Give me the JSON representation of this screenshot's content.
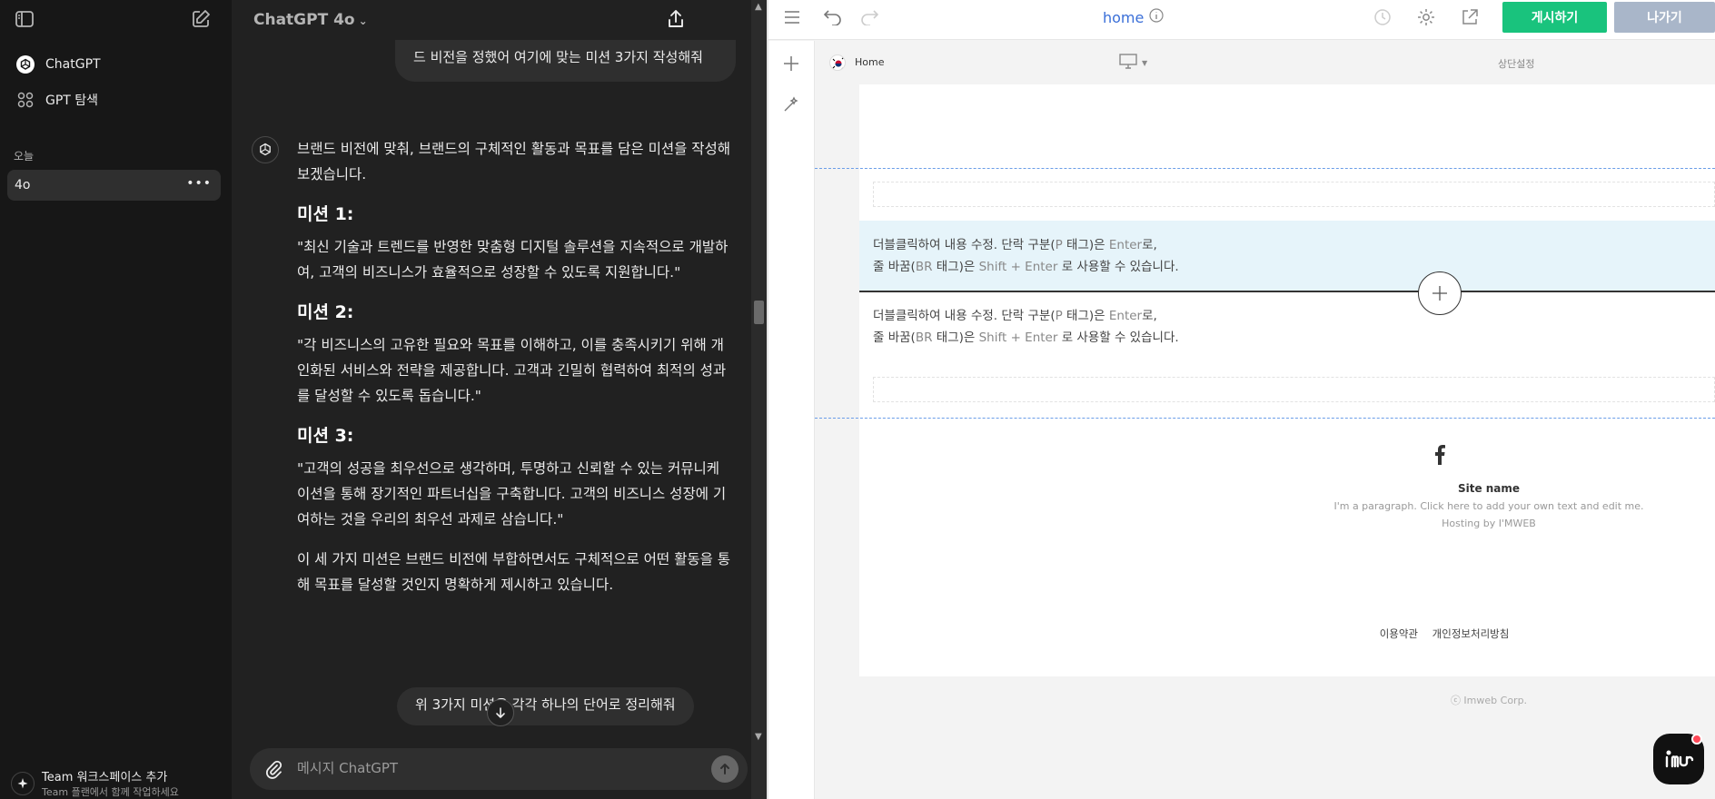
{
  "sidebar": {
    "items": [
      {
        "label": "ChatGPT",
        "icon": "chatgpt-logo-icon"
      },
      {
        "label": "GPT 탐색",
        "icon": "grid-icon"
      }
    ],
    "section_today": "오늘",
    "chat_title": "4o",
    "bottom_title": "Team 워크스페이스 추가",
    "bottom_subtitle": "Team 플랜에서 함께 작업하세요"
  },
  "chat": {
    "model": "ChatGPT 4o",
    "user_message_1": "드 비전을 정했어 여기에 맞는 미션 3가지 작성해줘",
    "ai_intro": "브랜드 비전에 맞춰, 브랜드의 구체적인 활동과 목표를 담은 미션을 작성해 보겠습니다.",
    "missions": [
      {
        "title": "미션 1:",
        "text": "\"최신 기술과 트렌드를 반영한 맞춤형 디지털 솔루션을 지속적으로 개발하여, 고객의 비즈니스가 효율적으로 성장할 수 있도록 지원합니다.\""
      },
      {
        "title": "미션 2:",
        "text": "\"각 비즈니스의 고유한 필요와 목표를 이해하고, 이를 충족시키기 위해 개인화된 서비스와 전략을 제공합니다. 고객과 긴밀히 협력하여 최적의 성과를 달성할 수 있도록 돕습니다.\""
      },
      {
        "title": "미션 3:",
        "text": "\"고객의 성공을 최우선으로 생각하며, 투명하고 신뢰할 수 있는 커뮤니케이션을 통해 장기적인 파트너십을 구축합니다. 고객의 비즈니스 성장에 기여하는 것을 우리의 최우선 과제로 삼습니다.\""
      }
    ],
    "ai_outro": "이 세 가지 미션은 브랜드 비전에 부합하면서도 구체적으로 어떤 활동을 통해 목표를 달성할 것인지 명확하게 제시하고 있습니다.",
    "user_message_2": "위 3가지 미션을 각각 하나의 단어로 정리해줘",
    "composer_placeholder": "메시지 ChatGPT"
  },
  "editor": {
    "page_name": "home",
    "publish_label": "게시하기",
    "exit_label": "나가기",
    "breadcrumb_home": "Home",
    "top_setting": "상단설정",
    "para_line1_a": "더블클릭하여 내용 수정. 단락 구분(",
    "para_line1_b": "P",
    "para_line1_c": " 태그)은 ",
    "para_line1_d": "Enter",
    "para_line1_e": "로,",
    "para_line2_a": "줄 바꿈(",
    "para_line2_b": "BR",
    "para_line2_c": " 태그)은 ",
    "para_line2_d": "Shift + Enter",
    "para_line2_e": " 로 사용할 수 있습니다.",
    "footer_site_name": "Site name",
    "footer_paragraph": "I'm a paragraph. Click here to add your own text and edit me.",
    "footer_hosting": "Hosting by I'MWEB",
    "footer_terms": "이용약관",
    "footer_privacy": "개인정보처리방침",
    "copyright": "ⓒ Imweb Corp."
  },
  "colors": {
    "chat_bg": "#212121",
    "sidebar_bg": "#171717",
    "publish_green": "#19c37d",
    "exit_gray": "#a9b6c9",
    "link_blue": "#3a6fd8"
  }
}
